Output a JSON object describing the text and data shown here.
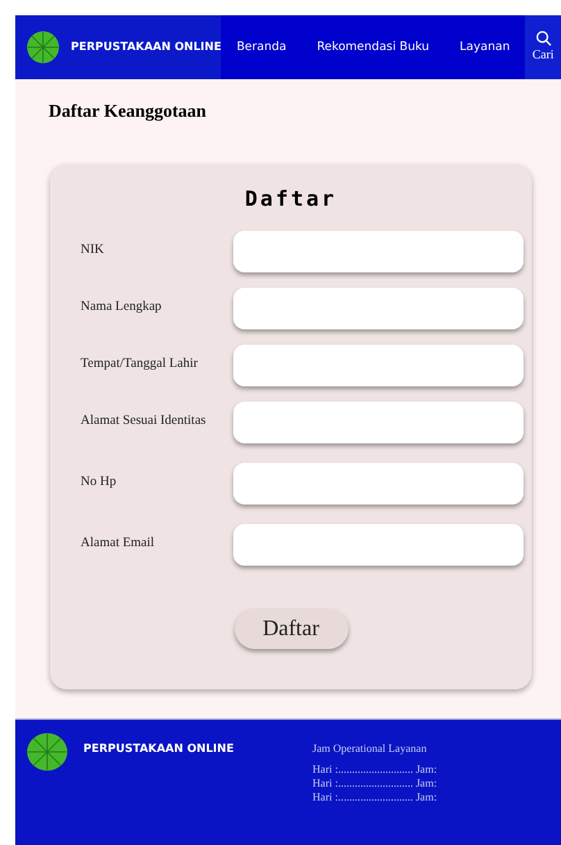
{
  "header": {
    "brand": "PERPUSTAKAAN ONLINE",
    "nav": [
      {
        "label": "Beranda"
      },
      {
        "label": "Rekomendasi Buku"
      },
      {
        "label": "Layanan"
      }
    ],
    "search_label": "Cari"
  },
  "page_title": "Daftar Keanggotaan",
  "form": {
    "title": "Daftar",
    "fields": [
      {
        "label": "NIK"
      },
      {
        "label": "Nama Lengkap"
      },
      {
        "label": "Tempat/Tanggal Lahir"
      },
      {
        "label": "Alamat Sesuai Identitas"
      },
      {
        "label": "No Hp"
      },
      {
        "label": "Alamat Email"
      }
    ],
    "submit": "Daftar"
  },
  "footer": {
    "brand": "PERPUSTAKAAN ONLINE",
    "hours_title": "Jam Operational Layanan",
    "hours": [
      "Hari :........................... Jam:",
      "Hari :........................... Jam:",
      "Hari :........................... Jam:"
    ]
  }
}
